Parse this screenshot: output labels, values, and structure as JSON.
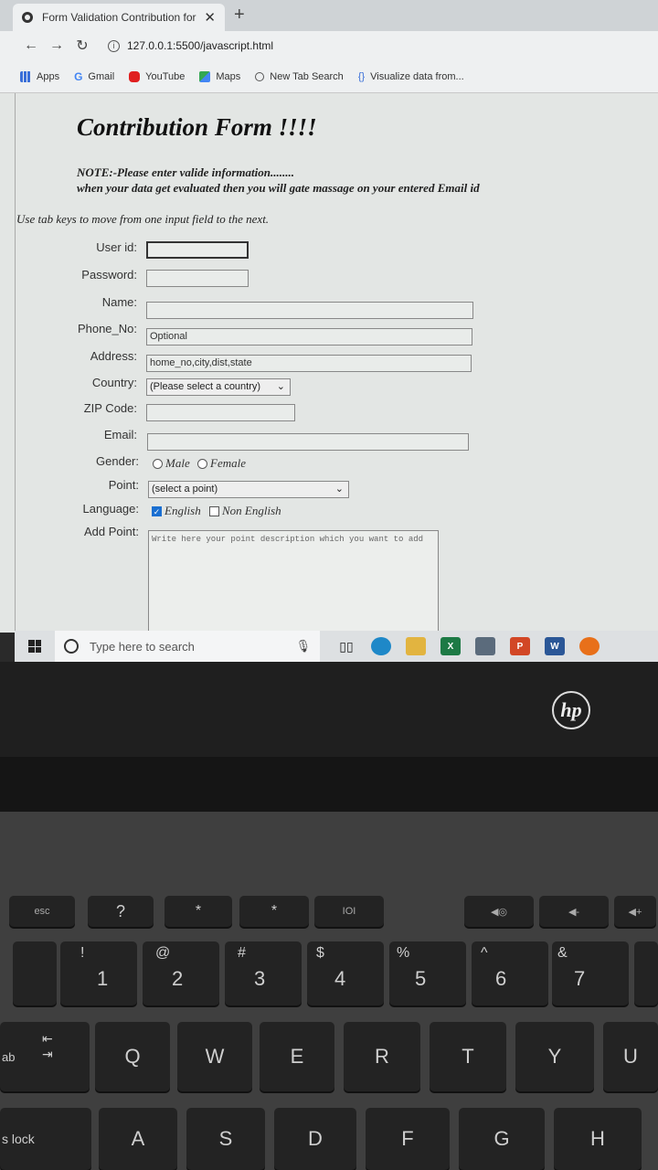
{
  "browser": {
    "tab_title": "Form Validation Contribution for",
    "url": "127.0.0.1:5500/javascript.html",
    "bookmarks": [
      "Apps",
      "Gmail",
      "YouTube",
      "Maps",
      "New Tab Search",
      "Visualize data from..."
    ]
  },
  "page": {
    "heading": "Contribution Form !!!!",
    "note_line1": "NOTE:-Please enter valide information........",
    "note_line2": "when your data get evaluated then you will gate massage on your entered Email id",
    "hint": "Use tab keys to move from one input field to the next."
  },
  "form": {
    "userid_label": "User id:",
    "password_label": "Password:",
    "name_label": "Name:",
    "phone_label": "Phone_No:",
    "phone_placeholder": "Optional",
    "address_label": "Address:",
    "address_placeholder": "home_no,city,dist,state",
    "country_label": "Country:",
    "country_selected": "(Please select a country)",
    "zip_label": "ZIP Code:",
    "email_label": "Email:",
    "gender_label": "Gender:",
    "gender_male": "Male",
    "gender_female": "Female",
    "point_label": "Point:",
    "point_selected": "(select a point)",
    "language_label": "Language:",
    "lang_english": "English",
    "lang_non_english": "Non English",
    "addpoint_label": "Add Point:",
    "addpoint_placeholder": "Write here your point description which you want to add"
  },
  "taskbar": {
    "search_placeholder": "Type here to search"
  },
  "laptop": {
    "brand": "hp",
    "keys_row1": [
      "esc",
      "?",
      "*",
      "*",
      "IOI",
      "◀◎",
      "◀-",
      "◀+"
    ],
    "keys_row2": [
      "1",
      "2",
      "3",
      "4",
      "5",
      "6",
      "7"
    ],
    "keys_row2_shift": [
      "!",
      "@",
      "#",
      "$",
      "%",
      "^",
      "&"
    ],
    "keys_row3": [
      "Q",
      "W",
      "E",
      "R",
      "T",
      "Y",
      "U"
    ],
    "keys_row4": [
      "A",
      "S",
      "D",
      "F",
      "G",
      "H"
    ],
    "tab_key": "ab",
    "caps_key": "s lock"
  }
}
